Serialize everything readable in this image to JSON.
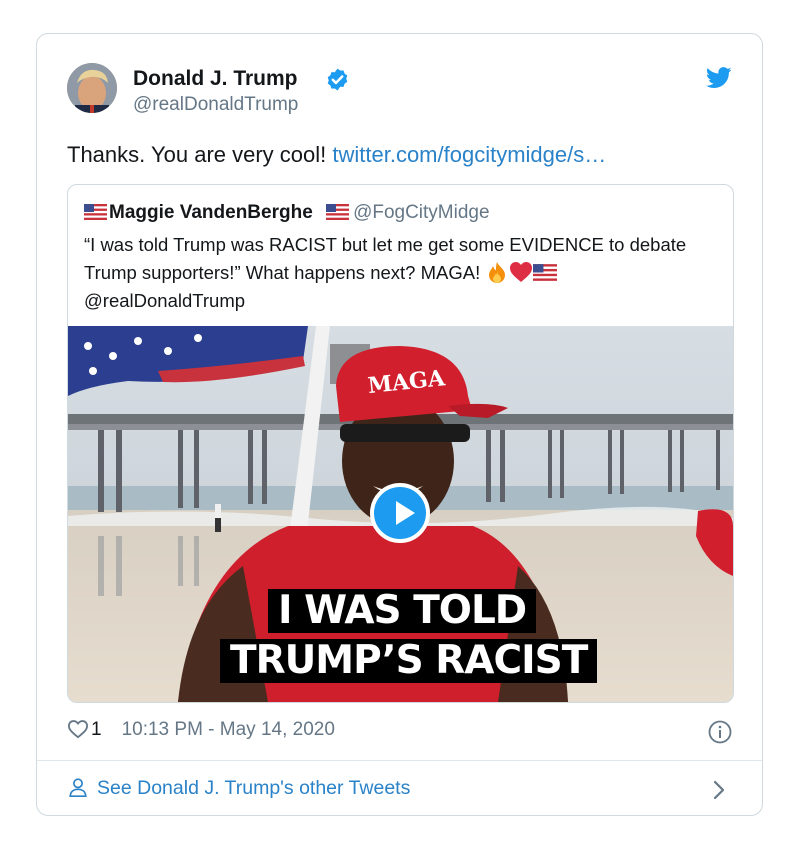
{
  "tweet": {
    "author_name": "Donald J. Trump",
    "author_handle": "@realDonaldTrump",
    "text": "Thanks. You are very cool! ",
    "link_text": "twitter.com/fogcitymidge/s…",
    "like_count": "1",
    "timestamp": "10:13 PM - May 14, 2020"
  },
  "quoted_tweet": {
    "author_name": "Maggie VandenBerghe",
    "author_handle": "@FogCityMidge",
    "text": "“I was told Trump was RACIST but let me get some EVIDENCE to debate Trump supporters!” What happens next? MAGA! ",
    "mention": "@realDonaldTrump",
    "video_caption_line1": "I WAS TOLD",
    "video_caption_line2": "TRUMP’S RACIST",
    "hat_text": "MAGA"
  },
  "footer": {
    "see_more_label": "See Donald J. Trump's other Tweets"
  },
  "colors": {
    "link_blue": "#2a82c8",
    "verified_blue": "#1d9bf0",
    "border": "#cfd9de",
    "secondary_text": "#657786"
  },
  "icons": [
    "verified-badge-icon",
    "twitter-bird-icon",
    "us-flag-icon",
    "fire-emoji-icon",
    "red-heart-emoji-icon",
    "play-icon",
    "heart-icon",
    "info-icon",
    "person-icon",
    "chevron-right-icon"
  ]
}
